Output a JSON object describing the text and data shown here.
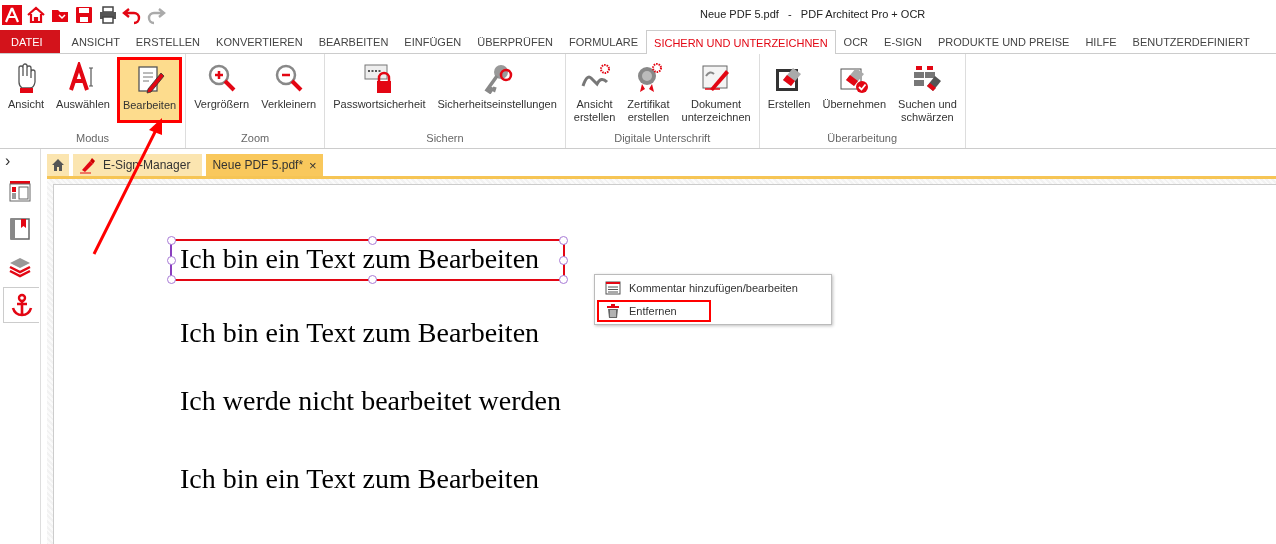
{
  "window": {
    "title": "Neue PDF 5.pdf   -   PDF Architect Pro + OCR"
  },
  "menu_tabs": [
    {
      "label": "DATEI",
      "kind": "file"
    },
    {
      "label": "ANSICHT",
      "kind": "tab",
      "selected": false
    },
    {
      "label": "ERSTELLEN",
      "kind": "tab",
      "selected": false
    },
    {
      "label": "KONVERTIEREN",
      "kind": "tab",
      "selected": false
    },
    {
      "label": "BEARBEITEN",
      "kind": "tab",
      "selected": false
    },
    {
      "label": "EINFÜGEN",
      "kind": "tab",
      "selected": false
    },
    {
      "label": "ÜBERPRÜFEN",
      "kind": "tab",
      "selected": false
    },
    {
      "label": "FORMULARE",
      "kind": "tab",
      "selected": false
    },
    {
      "label": "SICHERN UND UNTERZEICHNEN",
      "kind": "tab",
      "selected": true
    },
    {
      "label": "OCR",
      "kind": "tab",
      "selected": false
    },
    {
      "label": "E-SIGN",
      "kind": "tab",
      "selected": false
    },
    {
      "label": "PRODUKTE UND PREISE",
      "kind": "tab",
      "selected": false
    },
    {
      "label": "HILFE",
      "kind": "tab",
      "selected": false
    },
    {
      "label": "BENUTZERDEFINIERT",
      "kind": "tab",
      "selected": false
    }
  ],
  "ribbon_groups": [
    {
      "label": "Modus",
      "buttons": [
        {
          "label": "Ansicht",
          "selected": false,
          "annotated": false
        },
        {
          "label": "Auswählen",
          "selected": false,
          "annotated": false
        },
        {
          "label": "Bearbeiten",
          "selected": true,
          "annotated": true
        }
      ]
    },
    {
      "label": "Zoom",
      "buttons": [
        {
          "label": "Vergrößern",
          "selected": false,
          "annotated": false
        },
        {
          "label": "Verkleinern",
          "selected": false,
          "annotated": false
        }
      ]
    },
    {
      "label": "Sichern",
      "buttons": [
        {
          "label": "Passwortsicherheit",
          "selected": false,
          "annotated": false
        },
        {
          "label": "Sicherheitseinstellungen",
          "selected": false,
          "annotated": false
        }
      ]
    },
    {
      "label": "Digitale Unterschrift",
      "buttons": [
        {
          "label": "Ansicht\nerstellen",
          "selected": false,
          "annotated": false
        },
        {
          "label": "Zertifikat\nerstellen",
          "selected": false,
          "annotated": false
        },
        {
          "label": "Dokument\nunterzeichnen",
          "selected": false,
          "annotated": false
        }
      ]
    },
    {
      "label": "Überarbeitung",
      "buttons": [
        {
          "label": "Erstellen",
          "selected": false,
          "annotated": false
        },
        {
          "label": "Übernehmen",
          "selected": false,
          "annotated": false
        },
        {
          "label": "Suchen und\nschwärzen",
          "selected": false,
          "annotated": false
        }
      ]
    }
  ],
  "doc_tabs": [
    {
      "label": "E-Sign-Manager",
      "selected": false,
      "closable": false
    },
    {
      "label": "Neue PDF 5.pdf*",
      "selected": true,
      "closable": true
    }
  ],
  "close_glyph": "×",
  "sidebar": {
    "expand_glyph": "›",
    "items": [
      {
        "selected": false
      },
      {
        "selected": false
      },
      {
        "selected": false
      },
      {
        "selected": true
      }
    ]
  },
  "document": {
    "lines": [
      {
        "text": "Ich bin ein Text zum Bearbeiten",
        "selected": true
      },
      {
        "text": "Ich bin ein Text zum Bearbeiten",
        "selected": false
      },
      {
        "text": "Ich werde nicht bearbeitet werden",
        "selected": false
      },
      {
        "text": "Ich bin ein Text zum Bearbeiten",
        "selected": false
      }
    ]
  },
  "context_menu": {
    "items": [
      {
        "label": "Kommentar hinzufügen/bearbeiten",
        "annotated": false
      },
      {
        "label": "Entfernen",
        "annotated": true
      }
    ]
  },
  "annotation_arrow": true
}
